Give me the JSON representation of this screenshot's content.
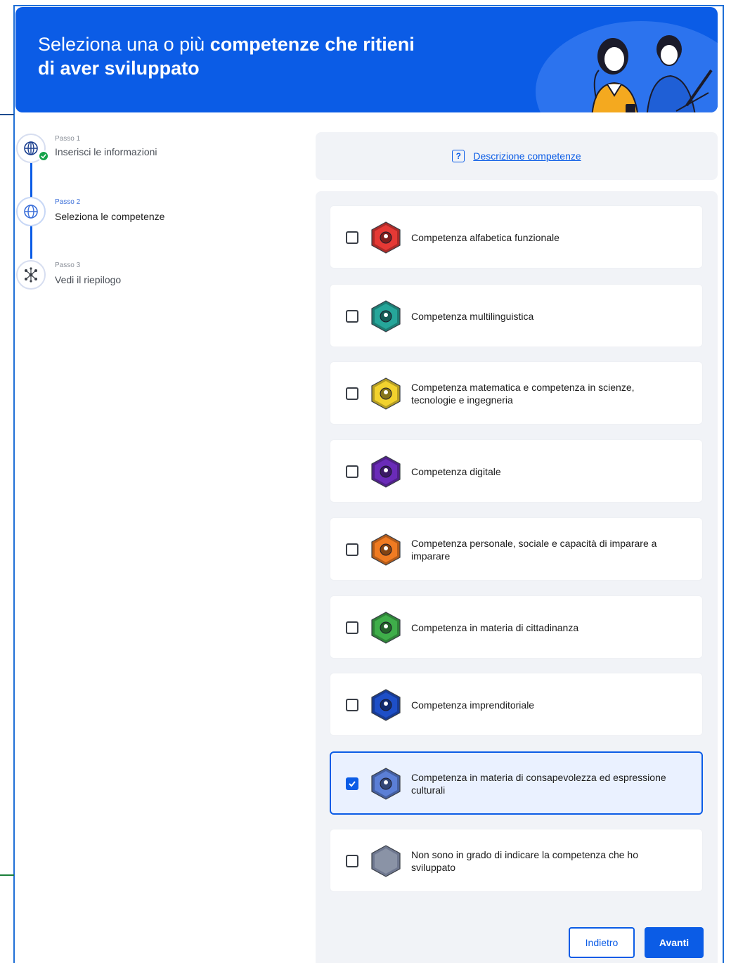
{
  "banner": {
    "title_regular": "Seleziona una o più ",
    "title_bold_1": "competenze che ritieni",
    "title_bold_2": "di aver sviluppato"
  },
  "stepper": [
    {
      "small": "Passo 1",
      "label": "Inserisci le informazioni",
      "status": "completed",
      "icon": "globe-icon"
    },
    {
      "small": "Passo 2",
      "label": "Seleziona le competenze",
      "status": "active",
      "icon": "globe-icon"
    },
    {
      "small": "Passo 3",
      "label": "Vedi il riepilogo",
      "status": "pending",
      "icon": "network-icon"
    }
  ],
  "description": {
    "link_label": "Descrizione competenze",
    "icon": "info-icon"
  },
  "competences": [
    {
      "label": "Competenza alfabetica funzionale",
      "checked": false,
      "color": "#e53935"
    },
    {
      "label": "Competenza multilinguistica",
      "checked": false,
      "color": "#26a69a"
    },
    {
      "label": "Competenza matematica e competenza in scienze, tecnologie e ingegneria",
      "checked": false,
      "color": "#f2d22e"
    },
    {
      "label": "Competenza digitale",
      "checked": false,
      "color": "#6a2bb8"
    },
    {
      "label": "Competenza personale, sociale e capacità di imparare a imparare",
      "checked": false,
      "color": "#f07b22"
    },
    {
      "label": "Competenza in materia di cittadinanza",
      "checked": false,
      "color": "#3fae4a"
    },
    {
      "label": "Competenza imprenditoriale",
      "checked": false,
      "color": "#1e4fc7"
    },
    {
      "label": "Competenza in materia di consapevolezza ed espressione culturali",
      "checked": true,
      "color": "#5b7fd6"
    },
    {
      "label": "Non sono in grado di indicare la competenza che ho sviluppato",
      "checked": false,
      "color": "#8a93a6"
    }
  ],
  "buttons": {
    "back": "Indietro",
    "next": "Avanti"
  },
  "colors": {
    "primary": "#0b5ce6",
    "panel_bg": "#f1f3f7",
    "success": "#16a34a"
  }
}
